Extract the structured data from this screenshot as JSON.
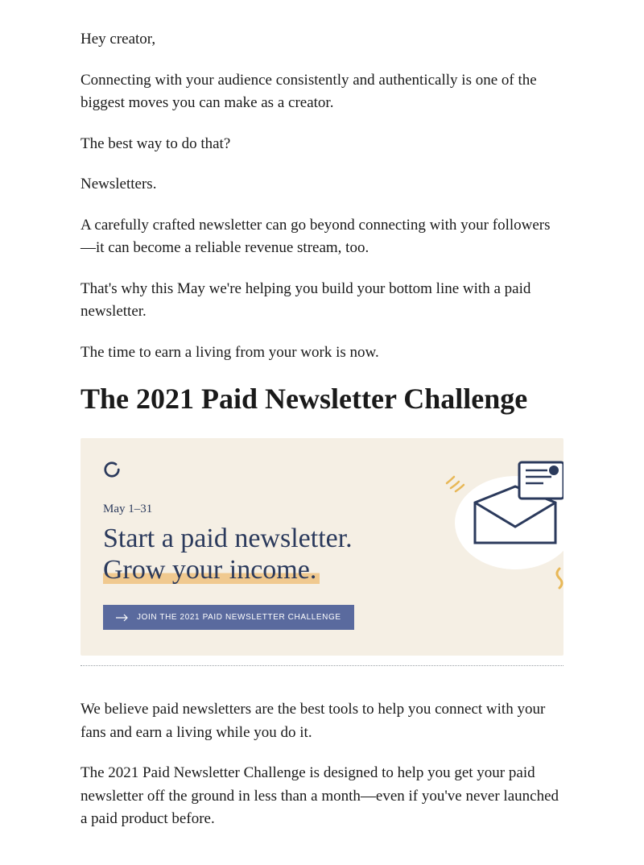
{
  "intro": {
    "greeting": "Hey creator,",
    "p1": "Connecting with your audience consistently and authentically is one of the biggest moves you can make as a creator.",
    "p2": "The best way to do that?",
    "p3": "Newsletters.",
    "p4": "A carefully crafted newsletter can go beyond connecting with your followers—it can become a reliable revenue stream, too.",
    "p5": "That's why this May we're helping you build your bottom line with a paid newsletter.",
    "p6": "The time to earn a living from your work is now."
  },
  "heading": "The 2021 Paid Newsletter Challenge",
  "promo": {
    "date": "May 1–31",
    "title_line1": "Start a paid newsletter.",
    "title_line2": "Grow your income.",
    "button_label": "JOIN THE 2021 PAID NEWSLETTER CHALLENGE"
  },
  "body": {
    "p1": "We believe paid newsletters are the best tools to help you connect with your fans and earn a living while you do it.",
    "p2": "The 2021 Paid Newsletter Challenge is designed to help you get your paid newsletter off the ground in less than a month—even if you've never launched a paid product before."
  },
  "colors": {
    "text": "#1a1a1a",
    "promo_bg": "#f5efe4",
    "promo_text": "#2b3a5c",
    "button_bg": "#5a6a9e",
    "highlight": "#f0c98f",
    "accent": "#e8b858"
  }
}
